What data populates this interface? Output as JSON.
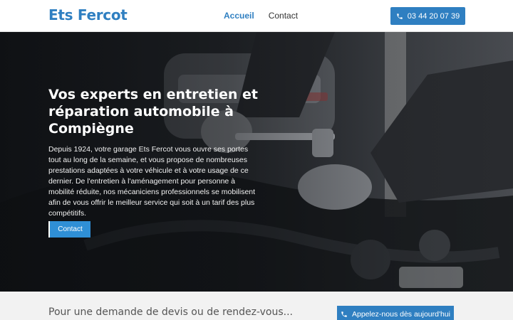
{
  "header": {
    "logo": "Ets Fercot",
    "nav": [
      {
        "label": "Accueil",
        "active": true
      },
      {
        "label": "Contact",
        "active": false
      }
    ],
    "phone_button": "03 44 20 07 39"
  },
  "hero": {
    "title": "Vos experts en entretien et réparation automobile à Compiègne",
    "text": "Depuis 1924, votre garage Ets Fercot vous ouvre ses portes tout au long de la semaine, et vous propose de nombreuses prestations adaptées à votre véhicule et à votre usage de ce dernier. De l'entretien à l'aménagement pour personne à mobilité réduite, nos mécaniciens professionnels se mobilisent afin de vous offrir le meilleur service qui soit à un tarif des plus compétitifs.",
    "button": "Contact"
  },
  "band": {
    "text": "Pour une demande de devis ou de rendez-vous...",
    "button": "Appelez-nous dès aujourd'hui"
  },
  "colors": {
    "accent": "#2f7fc1",
    "hero_button": "#2f8fd6",
    "band_background": "#f2f2f2"
  },
  "icons": {
    "phone": "phone-icon"
  }
}
